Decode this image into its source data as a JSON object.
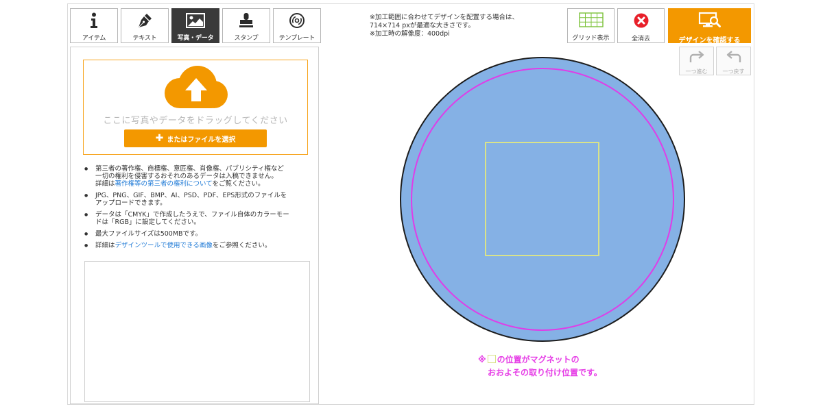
{
  "tabs": [
    {
      "label": "アイテム",
      "icon": "info-icon",
      "active": false
    },
    {
      "label": "テキスト",
      "icon": "pen-icon",
      "active": false
    },
    {
      "label": "写真・データ",
      "icon": "image-icon",
      "active": true
    },
    {
      "label": "スタンプ",
      "icon": "stamp-icon",
      "active": false
    },
    {
      "label": "テンプレート",
      "icon": "template-disc-icon",
      "active": false
    }
  ],
  "info": {
    "line1": "※加工範囲に合わせてデザインを配置する場合は、",
    "line2": "714×714 pxが最適な大きさです。",
    "line3": "※加工時の解像度：400dpi"
  },
  "toolbar": {
    "grid_label": "グリッド表示",
    "clear_label": "全消去",
    "confirm_label": "デザインを確認する",
    "redo_label": "一つ進む",
    "undo_label": "一つ戻す"
  },
  "upload": {
    "hint": "ここに写真やデータをドラッグしてください",
    "button_label": "またはファイルを選択",
    "button_icon": "plus-icon"
  },
  "notes": {
    "n1": {
      "line1": "第三者の著作権、商標権、意匠権、肖像権、パブリシティ権など",
      "line2": "一切の権利を侵害するおそれのあるデータは入稿できません。",
      "line3_prefix": "詳細は",
      "line3_link": "著作権等の第三者の権利について",
      "line3_suffix": "をご覧ください。"
    },
    "n2": {
      "line1": "JPG、PNG、GIF、BMP、AI、PSD、PDF、EPS形式のファイルを",
      "line2": "アップロードできます。"
    },
    "n3": {
      "line1": "データは「CMYK」で作成したうえで、ファイル自体のカラーモー",
      "line2": "ドは「RGB」に設定してください。"
    },
    "n4": {
      "line1": "最大ファイルサイズは500MBです。"
    },
    "n5": {
      "prefix": "詳細は",
      "link": "デザインツールで使用できる画像",
      "suffix": "をご参照ください。"
    }
  },
  "canvas": {
    "fill_color": "#85b1e5",
    "outline_color": "#1c1c1c",
    "safe_line_color": "#e03ce8",
    "magnet_marker_color": "#d9e38a"
  },
  "magnet_note": {
    "prefix": "※",
    "line1": "の位置がマグネットの",
    "line2": "おおよその取り付け位置です。"
  },
  "colors": {
    "accent": "#f39800",
    "link": "#1f7ad6",
    "active_tab": "#3a3a3a"
  }
}
